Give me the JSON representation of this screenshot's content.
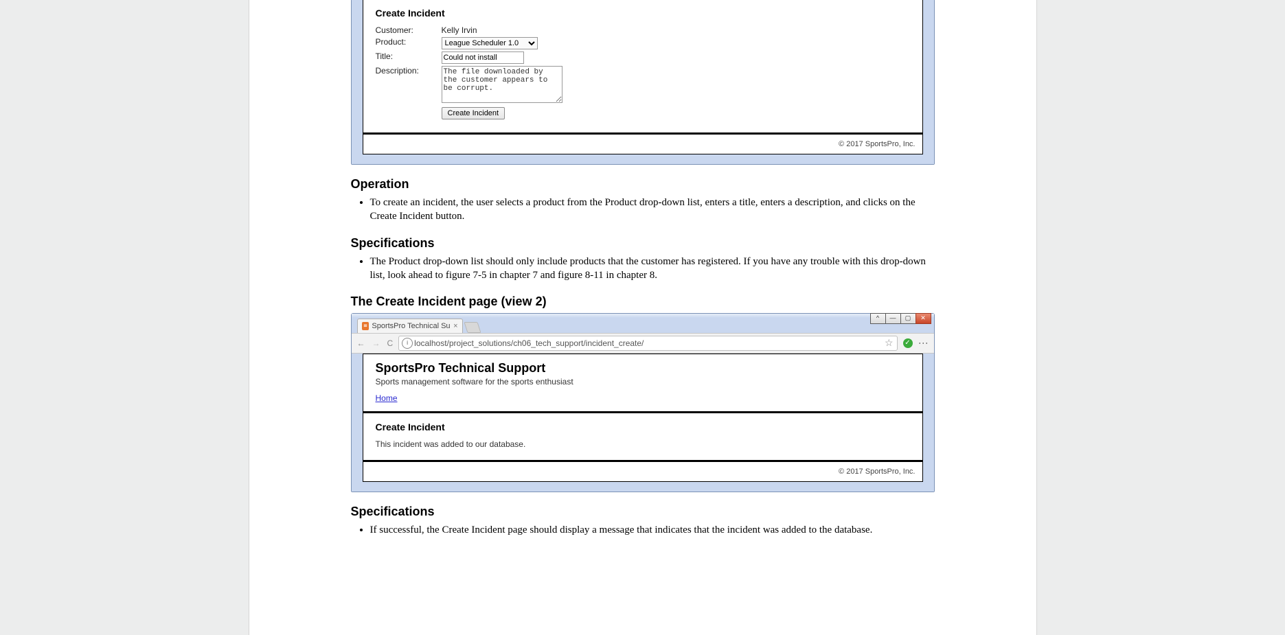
{
  "view1": {
    "form_title": "Create Incident",
    "customer_label": "Customer:",
    "customer_value": "Kelly Irvin",
    "product_label": "Product:",
    "product_value": "League Scheduler 1.0",
    "title_label": "Title:",
    "title_value": "Could not install",
    "description_label": "Description:",
    "description_value": "The file downloaded by the customer appears to be corrupt.",
    "submit_label": "Create Incident",
    "footer": "© 2017 SportsPro, Inc."
  },
  "headings": {
    "operation": "Operation",
    "specs1": "Specifications",
    "view2_title": "The Create Incident page (view 2)",
    "specs2": "Specifications"
  },
  "bullets": {
    "operation_1": "To create an incident, the user selects a product from the Product drop-down list, enters a title, enters a description, and clicks on the Create Incident button.",
    "specs1_1": "The Product drop-down list should only include products that the customer has registered. If you have any trouble with this drop-down list, look ahead to figure 7-5 in chapter 7 and figure 8-11 in chapter 8.",
    "specs2_1": "If successful, the Create Incident page should display a message that indicates that the incident was added to the database."
  },
  "view2": {
    "tab_title": "SportsPro Technical Supp",
    "url": "localhost/project_solutions/ch06_tech_support/incident_create/",
    "site_title": "SportsPro Technical Support",
    "site_sub": "Sports management software for the sports enthusiast",
    "home_link": "Home",
    "page_h2": "Create Incident",
    "message": "This incident was added to our database.",
    "footer": "© 2017 SportsPro, Inc."
  },
  "glyphs": {
    "back": "←",
    "fwd": "→",
    "reload": "C",
    "star": "☆",
    "dots": "⋮",
    "min": "—",
    "max": "▢",
    "close": "✕",
    "check": "✓",
    "tabx": "×",
    "caret": "^"
  }
}
